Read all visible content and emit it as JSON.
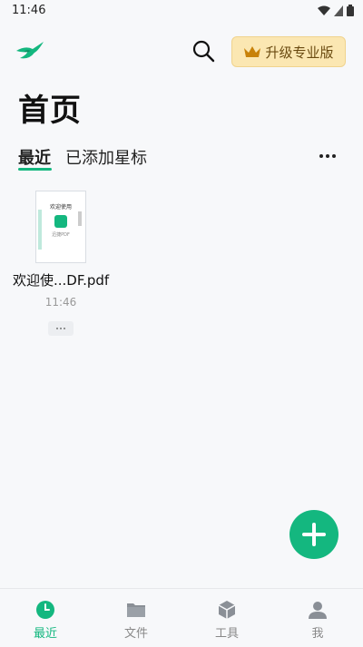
{
  "status_bar": {
    "time": "11:46"
  },
  "header": {
    "upgrade_label": "升级专业版",
    "icons": {
      "logo": "swift-bird-logo",
      "search": "search-icon",
      "crown": "crown-icon"
    }
  },
  "page": {
    "title": "首页"
  },
  "tabs": [
    {
      "label": "最近",
      "active": true
    },
    {
      "label": "已添加星标",
      "active": false
    }
  ],
  "files": [
    {
      "name": "欢迎使...DF.pdf",
      "time": "11:46",
      "thumbnail": {
        "heading": "欢迎使用",
        "caption": "迅捷PDF"
      }
    }
  ],
  "bottom_nav": [
    {
      "label": "最近",
      "icon": "clock-icon",
      "active": true
    },
    {
      "label": "文件",
      "icon": "folder-icon",
      "active": false
    },
    {
      "label": "工具",
      "icon": "toolbox-cube-icon",
      "active": false
    },
    {
      "label": "我",
      "icon": "person-icon",
      "active": false
    }
  ],
  "colors": {
    "accent": "#14b77f",
    "upgrade_bg": "#fbe7b2",
    "crown": "#c8820a"
  }
}
